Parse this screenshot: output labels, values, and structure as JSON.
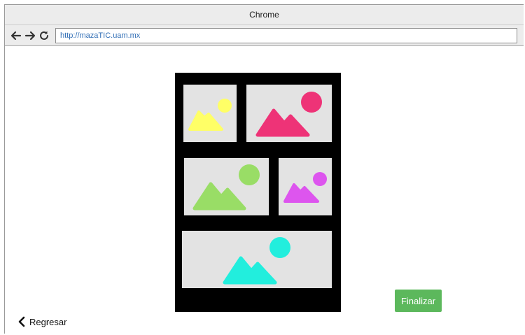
{
  "browser": {
    "window_title": "Chrome",
    "url": "http://mazaTIC.uam.mx"
  },
  "icons": {
    "back": "arrow-left-icon",
    "forward": "arrow-right-icon",
    "reload": "reload-icon",
    "regresar": "chevron-left-icon"
  },
  "gallery": {
    "tile_color": "#e3e3e3",
    "board_color": "#000000",
    "images": [
      {
        "name": "image-yellow",
        "color": "#ffff66"
      },
      {
        "name": "image-pink",
        "color": "#ee3377"
      },
      {
        "name": "image-green",
        "color": "#99dd66"
      },
      {
        "name": "image-purple",
        "color": "#dd55ee"
      },
      {
        "name": "image-cyan",
        "color": "#22eedd"
      }
    ]
  },
  "actions": {
    "finish_label": "Finalizar",
    "finish_color": "#5cb85c",
    "back_label": "Regresar"
  }
}
